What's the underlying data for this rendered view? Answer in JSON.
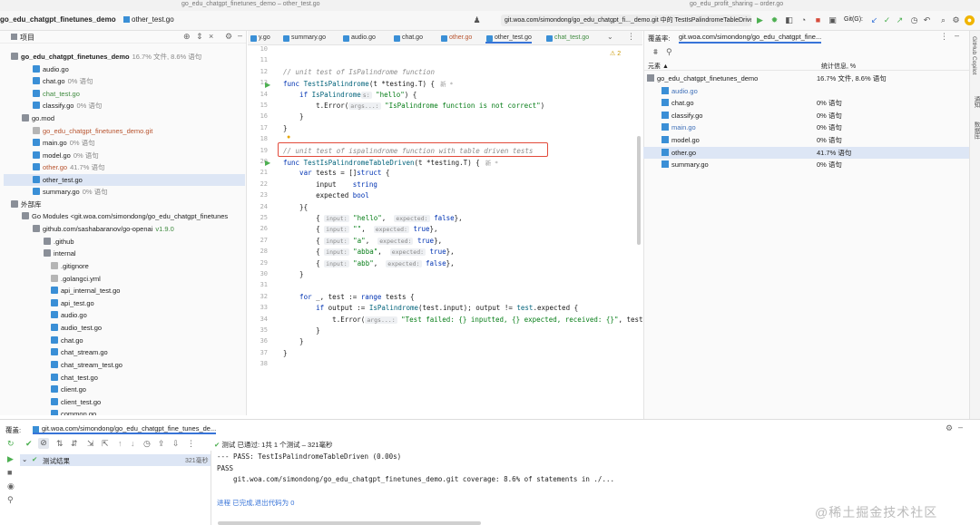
{
  "titlebar": {
    "left": "go_edu_chatgpt_finetunes_demo – other_test.go",
    "right": "go_edu_profit_sharing – order.go"
  },
  "toolbar": {
    "project_name": "go_edu_chatgpt_finetunes_demo",
    "file": "other_test.go",
    "run_config": "git.woa.com/simondong/go_edu_chatgpt_fi..._demo.git 中的 TestIsPalindromeTableDriven",
    "git_label": "Git(G):"
  },
  "project": {
    "header": "项目",
    "items": [
      {
        "label": "go_edu_chatgpt_finetunes_demo",
        "pct": "16.7% 文件, 8.6% 语句",
        "icon": "folder-icon",
        "bold": true
      },
      {
        "label": "audio.go",
        "pct": "",
        "icon": "go-file-icon"
      },
      {
        "label": "chat.go",
        "pct": "0% 语句",
        "icon": "go-file-icon"
      },
      {
        "label": "chat_test.go",
        "pct": "",
        "icon": "go-file-icon"
      },
      {
        "label": "classify.go",
        "pct": "0% 语句",
        "icon": "go-file-icon"
      },
      {
        "label": "go.mod",
        "pct": "",
        "icon": "folder-icon"
      },
      {
        "label": "go_edu_chatgpt_finetunes_demo.git",
        "pct": "",
        "icon": "text-file-icon"
      },
      {
        "label": "main.go",
        "pct": "0% 语句",
        "icon": "go-file-icon"
      },
      {
        "label": "model.go",
        "pct": "0% 语句",
        "icon": "go-file-icon"
      },
      {
        "label": "other.go",
        "pct": "41.7% 语句",
        "icon": "go-file-icon"
      },
      {
        "label": "other_test.go",
        "pct": "",
        "icon": "go-file-icon"
      },
      {
        "label": "summary.go",
        "pct": "0% 语句",
        "icon": "go-file-icon"
      },
      {
        "label": "外部库",
        "pct": "",
        "icon": "library-icon"
      },
      {
        "label": "Go Modules <git.woa.com/simondong/go_edu_chatgpt_finetunes",
        "pct": "",
        "icon": "module-icon"
      },
      {
        "label": "github.com/sashabaranov/go-openai",
        "pct": "v1.9.0",
        "icon": "folder-icon"
      },
      {
        "label": ".github",
        "pct": "",
        "icon": "folder-icon"
      },
      {
        "label": "internal",
        "pct": "",
        "icon": "folder-icon"
      },
      {
        "label": ".gitignore",
        "pct": "",
        "icon": "text-file-icon"
      },
      {
        "label": ".golangci.yml",
        "pct": "",
        "icon": "text-file-icon"
      },
      {
        "label": "api_internal_test.go",
        "pct": "",
        "icon": "go-file-icon"
      },
      {
        "label": "api_test.go",
        "pct": "",
        "icon": "go-file-icon"
      },
      {
        "label": "audio.go",
        "pct": "",
        "icon": "go-file-icon"
      },
      {
        "label": "audio_test.go",
        "pct": "",
        "icon": "go-file-icon"
      },
      {
        "label": "chat.go",
        "pct": "",
        "icon": "go-file-icon"
      },
      {
        "label": "chat_stream.go",
        "pct": "",
        "icon": "go-file-icon"
      },
      {
        "label": "chat_stream_test.go",
        "pct": "",
        "icon": "go-file-icon"
      },
      {
        "label": "chat_test.go",
        "pct": "",
        "icon": "go-file-icon"
      },
      {
        "label": "client.go",
        "pct": "",
        "icon": "go-file-icon"
      },
      {
        "label": "client_test.go",
        "pct": "",
        "icon": "go-file-icon"
      },
      {
        "label": "common.go",
        "pct": "",
        "icon": "go-file-icon"
      }
    ]
  },
  "editor": {
    "tabs": [
      "y.go",
      "summary.go",
      "audio.go",
      "chat.go",
      "other.go",
      "other_test.go",
      "chat_test.go"
    ],
    "active_tab": "other_test.go",
    "warning_count": "2",
    "line_numbers": [
      "10",
      "11",
      "12",
      "13",
      "14",
      "15",
      "16",
      "17",
      "18",
      "19",
      "20",
      "21",
      "22",
      "23",
      "24",
      "25",
      "26",
      "27",
      "28",
      "29",
      "30",
      "31",
      "32",
      "33",
      "34",
      "35",
      "36",
      "37",
      "38"
    ],
    "author_hint": "新 *",
    "code": {
      "l12": "// unit test of IsPalindrome function",
      "l13a": "func ",
      "l13b": "TestIsPalindrome",
      "l13c": "(t *testing.T) {",
      "l14a": "    if ",
      "l14b": "IsPalindrome",
      "l14hint": "s:",
      "l14c": "\"hello\"",
      "l14d": ") {",
      "l15a": "        t.Error(",
      "l15hint": "args...:",
      "l15b": "\"IsPalindrome function is not correct\"",
      "l15c": ")",
      "l16": "    }",
      "l17": "}",
      "l19": "// unit test of ispalindrome function with table driven tests",
      "l20a": "func ",
      "l20b": "TestIsPalindromeTableDriven",
      "l20c": "(t *testing.T) {",
      "l21a": "    var ",
      "l21b": "tests = []",
      "l21c": "struct",
      "l21d": " {",
      "l22a": "        input    ",
      "l22b": "string",
      "l23a": "        expected ",
      "l23b": "bool",
      "l24": "    }{",
      "rows": [
        {
          "input": "\"hello\"",
          "expected": "false"
        },
        {
          "input": "\"\"",
          "expected": "true"
        },
        {
          "input": "\"a\"",
          "expected": "true"
        },
        {
          "input": "\"abba\"",
          "expected": "true"
        },
        {
          "input": "\"abb\"",
          "expected": "false"
        }
      ],
      "hint_input": "input:",
      "hint_expected": "expected:",
      "l30": "    }",
      "l32a": "    for ",
      "l32b": "_, test := ",
      "l32c": "range",
      "l32d": " tests {",
      "l33a": "        if ",
      "l33b": "output := ",
      "l33c": "IsPalindrome",
      "l33d": "(test.input); output != ",
      "l33e": "test",
      "l33f": ".expected {",
      "l34a": "            t.Error(",
      "l34hint": "args...:",
      "l34b": "\"Test failed: {} inputted, {} expected, received: {}\"",
      "l34c": ", test.",
      "l35": "        }",
      "l36": "    }",
      "l37": "}"
    }
  },
  "coverage": {
    "title": "覆盖率:",
    "tab": "git.woa.com/simondong/go_edu_chatgpt_fine...",
    "col_element": "元素 ▲",
    "col_stats": "统计信息, %",
    "rows": [
      {
        "name": "go_edu_chatgpt_finetunes_demo",
        "value": "16.7% 文件, 8.6% 语句"
      },
      {
        "name": "audio.go",
        "value": ""
      },
      {
        "name": "chat.go",
        "value": "0% 语句"
      },
      {
        "name": "classify.go",
        "value": "0% 语句"
      },
      {
        "name": "main.go",
        "value": "0% 语句"
      },
      {
        "name": "model.go",
        "value": "0% 语句"
      },
      {
        "name": "other.go",
        "value": "41.7% 语句"
      },
      {
        "name": "summary.go",
        "value": "0% 语句"
      }
    ],
    "side_labels": [
      "GitHub Copilot",
      "通知",
      "数据库"
    ]
  },
  "run": {
    "title": "覆盖:",
    "config": "git.woa.com/simondong/go_edu_chatgpt_fine_tunes_de...",
    "status_prefix": "测试",
    "status_passed": "已通过:",
    "status_detail": "1共 1 个测试 – 321毫秒",
    "tree_root": "测试结果",
    "tree_time": "321毫秒",
    "output": [
      "--- PASS: TestIsPalindromeTableDriven (0.00s)",
      "PASS",
      "    git.woa.com/simondong/go_edu_chatgpt_finetunes_demo.git coverage: 8.6% of statements in ./...",
      "",
      "进程 已完成,退出代码为 0"
    ],
    "watermark": "@稀土掘金技术社区"
  },
  "colors": {
    "accent": "#3874d8",
    "highlight_box": "#e24b3b",
    "pass_green": "#4caf50",
    "selected_row": "#dde6f5"
  }
}
